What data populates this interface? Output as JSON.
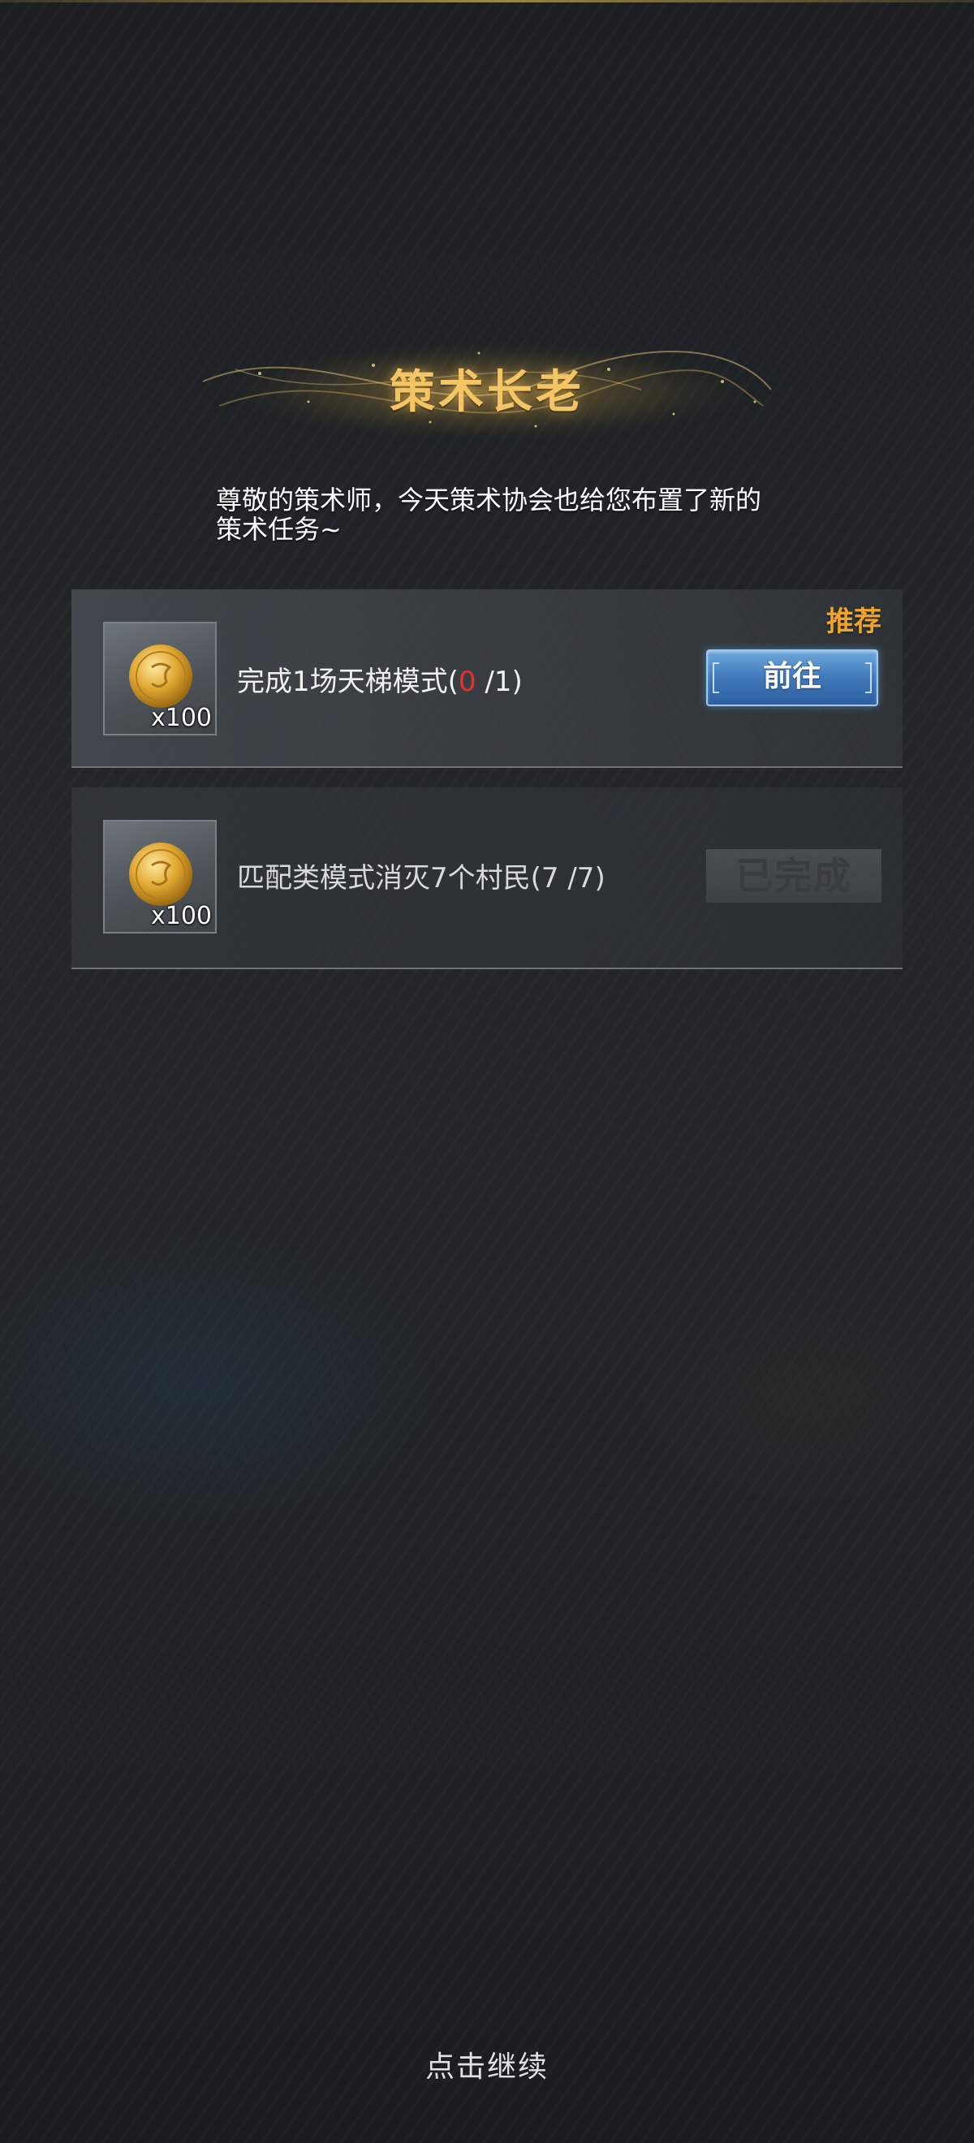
{
  "dialog": {
    "title": "策术长老",
    "intro": "尊敬的策术师，今天策术协会也给您布置了新的策术任务~"
  },
  "tasks": [
    {
      "recommend": "推荐",
      "reward_icon": "gold-coin-icon",
      "reward_qty": "x100",
      "text": "完成1场天梯模式",
      "progress_open": "(",
      "progress_current": "0",
      "progress_rest": " /1)",
      "button_label": "前往",
      "status": "active"
    },
    {
      "reward_icon": "gold-coin-icon",
      "reward_qty": "x100",
      "text": "匹配类模式消灭7个村民",
      "progress_open": "(",
      "progress_current": "7",
      "progress_rest": " /7)",
      "button_label": "已完成",
      "status": "completed"
    }
  ],
  "footer": {
    "continue": "点击继续"
  },
  "colors": {
    "title_gold": "#f3c565",
    "recommend_orange": "#f0a528",
    "progress_red": "#e3342b",
    "button_blue": "#3f79bb",
    "background": "#1f2327"
  }
}
